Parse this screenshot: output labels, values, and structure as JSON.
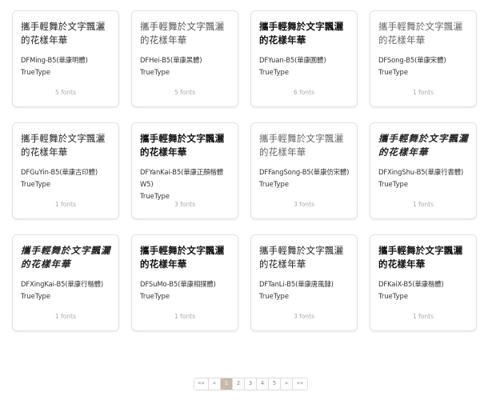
{
  "fonts": [
    {
      "sample": "攜手輕舞於文字飄灑的花樣年華",
      "name": "DFMing-B5(華康明體)",
      "type": "TrueType",
      "count": "5 fonts"
    },
    {
      "sample": "攜手輕舞於文字飄灑的花樣年華",
      "name": "DFHei-B5(華康黑體)",
      "type": "TrueType",
      "count": "5 fonts"
    },
    {
      "sample": "攜手輕舞於文字飄灑的花樣年華",
      "name": "DFYuan-B5(華康圓體)",
      "type": "TrueType",
      "count": "6 fonts"
    },
    {
      "sample": "攜手輕舞於文字飄灑的花樣年華",
      "name": "DFSong-B5(華康宋體)",
      "type": "TrueType",
      "count": "1 fonts"
    },
    {
      "sample": "攜手輕舞於文字飄灑的花樣年華",
      "name": "DFGuYin-B5(華康古印體)",
      "type": "TrueType",
      "count": "1 fonts"
    },
    {
      "sample": "攜手輕舞於文字飄灑的花樣年華",
      "name": "DFYanKai-B5(華康正顏楷體W5)",
      "type": "TrueType",
      "count": "3 fonts"
    },
    {
      "sample": "攜手輕舞於文字飄灑的花樣年華",
      "name": "DFFangSong-B5(華康仿宋體)",
      "type": "TrueType",
      "count": "3 fonts"
    },
    {
      "sample": "攜手輕舞於文字飄灑的花樣年華",
      "name": "DFXingShu-B5(華康行書體)",
      "type": "TrueType",
      "count": "1 fonts"
    },
    {
      "sample": "攜手輕舞於文字飄灑的花樣年華",
      "name": "DFXingKai-B5(華康行楷體)",
      "type": "TrueType",
      "count": "1 fonts"
    },
    {
      "sample": "攜手輕舞於文字飄灑的花樣年華",
      "name": "DFSuMo-B5(華康相撲體)",
      "type": "TrueType",
      "count": "1 fonts"
    },
    {
      "sample": "攜手輕舞於文字飄灑的花樣年華",
      "name": "DFTanLi-B5(華康唐風隸)",
      "type": "TrueType",
      "count": "3 fonts"
    },
    {
      "sample": "攜手輕舞於文字飄灑的花樣年華",
      "name": "DFKaiX-B5(華康楷體)",
      "type": "TrueType",
      "count": "1 fonts"
    }
  ],
  "pagination": {
    "first": "««",
    "prev": "«",
    "pages": [
      "1",
      "2",
      "3",
      "4",
      "5"
    ],
    "current": "1",
    "next": "»",
    "last": "»»"
  },
  "colors": {
    "active_page": "#c9b9a6",
    "card_border": "#e3e3e3",
    "muted_text": "#aaaaaa"
  }
}
